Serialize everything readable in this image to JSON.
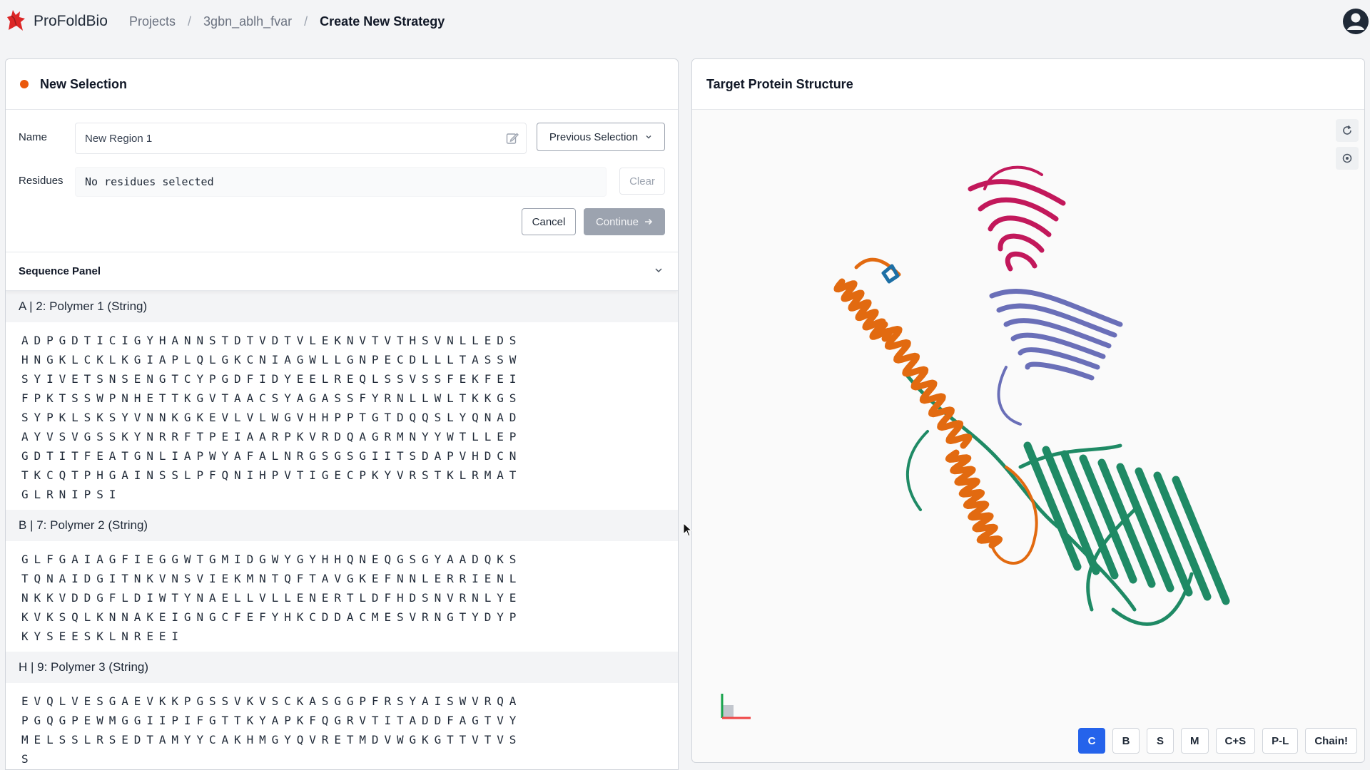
{
  "app": {
    "brand": "ProFoldBio",
    "breadcrumbs": [
      "Projects",
      "3gbn_ablh_fvar"
    ],
    "current_page": "Create New Strategy",
    "brand_color": "#dc2626",
    "accent_color": "#2563eb"
  },
  "selection": {
    "title": "New Selection",
    "status_color": "#ea580c",
    "name_label": "Name",
    "name_value": "New Region 1",
    "previous_selection_label": "Previous Selection",
    "residues_label": "Residues",
    "residues_value": "No residues selected",
    "clear_label": "Clear",
    "cancel_label": "Cancel",
    "continue_label": "Continue"
  },
  "sequence_panel": {
    "title": "Sequence Panel",
    "chains": [
      {
        "title": "A | 2: Polymer 1 (String)",
        "lines": [
          "ADPGDTICIGYHANNSTDTVDTVLEKNVTVTHSVNLLEDS",
          "HNGKLCKLKGIAPLQLGKCNIAGWLLGNPECDLLLTASSW",
          "SYIVETSNSENGTCYPGDFIDYEELREQLSSVSSFEKFEI",
          "FPKTSSWPNHETTKGVTAACSYAGASSFYRNLLWLTKKGS",
          "SYPKLSKSYVNNKGKEVLVLWGVHHPPTGTDQQSLYQNAD",
          "AYVSVGSSKYNRRFTPEIAARPKVRDQAGRMNYYWTLLEP",
          "GDTITFEATGNLIAPWYAFALNRGSGSGIITSDAPVHDCN",
          "TKCQTPHGAINSSLPFQNIHPVTIGECPKYVRSTKLRMAT",
          "GLRNIPSI"
        ]
      },
      {
        "title": "B | 7: Polymer 2 (String)",
        "lines": [
          "GLFGAIAGFIEGGWTGMIDGWYGYHHQNEQGSGYAADQKS",
          "TQNAIDGITNKVNSVIEKMNTQFTAVGKEFNNLERRIENL",
          "NKKVDDGFLDIWTYNAELLVLLENERTLDFHDSNVRNLYE",
          "KVKSQLKNNAKEIGNGCFEFYHKCDDACMESVRNGTYDYP",
          "KYSEESKLNREEI"
        ]
      },
      {
        "title": "H | 9: Polymer 3 (String)",
        "lines": [
          "EVQLVESGAEVKKPGSSVKVSCKASGGPFRSYAISWVRQA",
          "PGQGPEWMGGIIPIFGTTKYAPKFQGRVTITADDFAGTVY",
          "MELSSLRSEDTAMYYCAKHMGYQVRETMDVWGKGTTVTVS",
          "S"
        ]
      }
    ]
  },
  "structure": {
    "title": "Target Protein Structure",
    "representation_buttons": [
      "C",
      "B",
      "S",
      "M",
      "C+S",
      "P-L",
      "Chain!"
    ],
    "active_representation": "C",
    "chain_colors": [
      "#c2185b",
      "#6a6fb8",
      "#e26a10",
      "#1f8a65",
      "#1d6fa5"
    ],
    "tool_icons": [
      "reset-view-icon",
      "settings-icon"
    ]
  }
}
